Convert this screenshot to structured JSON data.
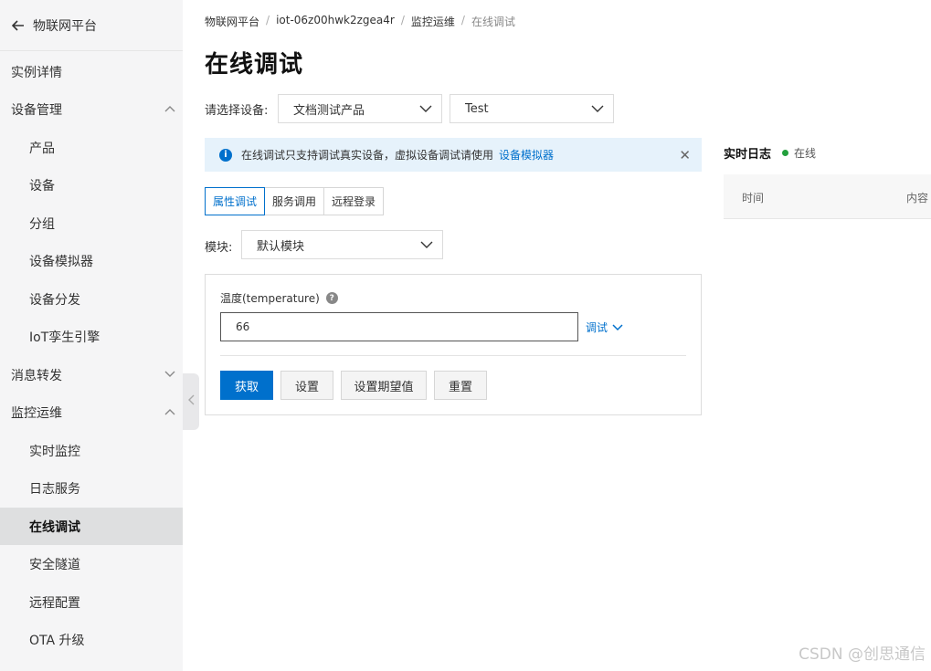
{
  "sidebar": {
    "header": "物联网平台",
    "items": [
      {
        "label": "实例详情"
      },
      {
        "label": "设备管理"
      },
      {
        "label": "产品"
      },
      {
        "label": "设备"
      },
      {
        "label": "分组"
      },
      {
        "label": "设备模拟器"
      },
      {
        "label": "设备分发"
      },
      {
        "label": "IoT孪生引擎"
      },
      {
        "label": "消息转发"
      },
      {
        "label": "监控运维"
      },
      {
        "label": "实时监控"
      },
      {
        "label": "日志服务"
      },
      {
        "label": "在线调试"
      },
      {
        "label": "安全隧道"
      },
      {
        "label": "远程配置"
      },
      {
        "label": "OTA 升级"
      }
    ]
  },
  "breadcrumb": [
    "物联网平台",
    "iot-06z00hwk2zgea4r",
    "监控运维",
    "在线调试"
  ],
  "page_title": "在线调试",
  "device_select": {
    "label": "请选择设备:",
    "product": "文档测试产品",
    "device": "Test"
  },
  "notice": {
    "text": "在线调试只支持调试真实设备，虚拟设备调试请使用",
    "link": "设备模拟器"
  },
  "tabs": [
    "属性调试",
    "服务调用",
    "远程登录"
  ],
  "module": {
    "label": "模块:",
    "value": "默认模块"
  },
  "property": {
    "label": "温度(temperature)",
    "value": "66",
    "debug_label": "调试"
  },
  "buttons": {
    "get": "获取",
    "set": "设置",
    "set_expected": "设置期望值",
    "reset": "重置"
  },
  "log": {
    "title": "实时日志",
    "status": "在线",
    "col_time": "时间",
    "col_content": "内容"
  },
  "watermark": "CSDN @创思通信",
  "colors": {
    "primary": "#0070cc",
    "online": "#23a03d",
    "notice_bg": "#e6f2fb",
    "sidebar_bg": "#f5f5f6"
  }
}
